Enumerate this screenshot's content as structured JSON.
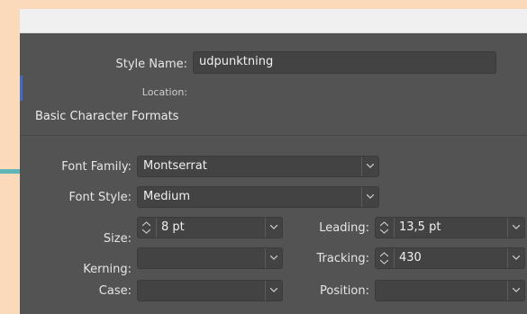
{
  "style_name": {
    "label": "Style Name:",
    "value": "udpunktning"
  },
  "location": {
    "label": "Location:"
  },
  "section_title": "Basic Character Formats",
  "font_family": {
    "label": "Font Family:",
    "value": "Montserrat"
  },
  "font_style": {
    "label": "Font Style:",
    "value": "Medium"
  },
  "size": {
    "label": "Size:",
    "value": "8 pt"
  },
  "leading": {
    "label": "Leading:",
    "value": "13,5 pt"
  },
  "kerning": {
    "label": "Kerning:",
    "value": ""
  },
  "tracking": {
    "label": "Tracking:",
    "value": "430"
  },
  "case": {
    "label": "Case:",
    "value": ""
  },
  "position": {
    "label": "Position:",
    "value": ""
  },
  "icons": [
    "chevron-down-icon",
    "spinner-icon"
  ],
  "colors": {
    "panel": "#535353",
    "field": "#434343",
    "background": "#fbd9bb",
    "accent": "#5fb5b8"
  }
}
